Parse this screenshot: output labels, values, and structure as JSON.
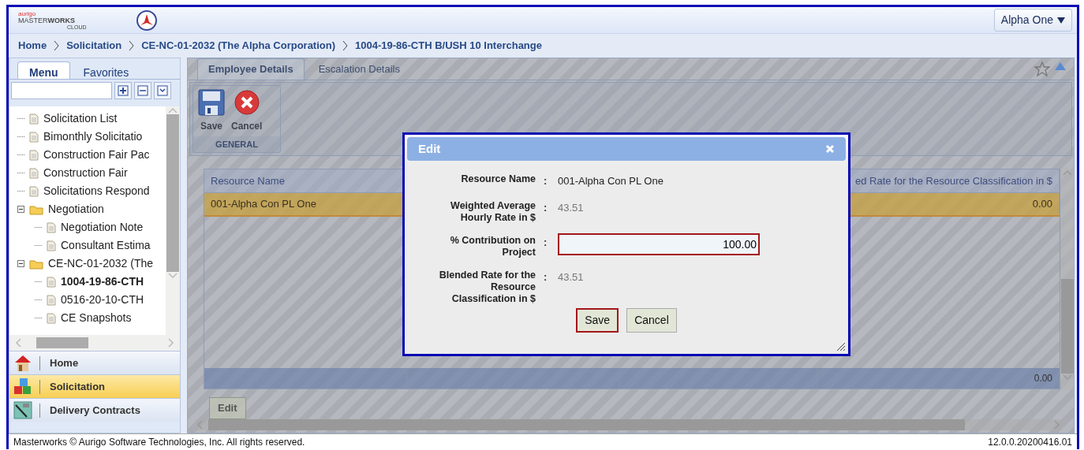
{
  "header": {
    "logo": {
      "brand": "aurigo",
      "name": "MASTER**WORKS**",
      "tagline": "CLOUD"
    },
    "user_menu": "Alpha One"
  },
  "breadcrumb": [
    "Home",
    "Solicitation",
    "CE-NC-01-2032 (The Alpha Corporation)",
    "1004-19-86-CTH B/USH 10 Interchange"
  ],
  "sidebar": {
    "tabs": [
      {
        "label": "Menu",
        "selected": true
      },
      {
        "label": "Favorites",
        "selected": false
      }
    ],
    "tree": [
      {
        "label": "Solicitation List",
        "kind": "page",
        "selected": false
      },
      {
        "label": "Bimonthly Solicitatio",
        "kind": "page",
        "selected": false
      },
      {
        "label": "Construction Fair Pac",
        "kind": "page",
        "selected": false
      },
      {
        "label": "Construction Fair",
        "kind": "page",
        "selected": false
      },
      {
        "label": "Solicitations Respond",
        "kind": "page",
        "selected": false
      },
      {
        "label": "Negotiation",
        "kind": "folder",
        "expanded": true,
        "selected": false,
        "children": [
          {
            "label": "Negotiation Note",
            "kind": "page",
            "selected": false
          },
          {
            "label": "Consultant Estima",
            "kind": "page",
            "selected": false
          }
        ]
      },
      {
        "label": "CE-NC-01-2032 (The",
        "kind": "folder",
        "expanded": true,
        "selected": false,
        "children": [
          {
            "label": "1004-19-86-CTH",
            "kind": "page",
            "selected": true
          },
          {
            "label": "0516-20-10-CTH",
            "kind": "page",
            "selected": false
          },
          {
            "label": "CE Snapshots",
            "kind": "page",
            "selected": false
          }
        ]
      }
    ],
    "nav": [
      {
        "label": "Home",
        "kind": "home",
        "selected": false
      },
      {
        "label": "Solicitation",
        "kind": "blocks",
        "selected": true
      },
      {
        "label": "Delivery Contracts",
        "kind": "contract",
        "selected": false
      }
    ]
  },
  "main": {
    "tabs": [
      {
        "label": "Employee Details",
        "selected": true
      },
      {
        "label": "Escalation Details",
        "selected": false
      }
    ],
    "toolbar": {
      "buttons": [
        {
          "label": "Save",
          "kind": "save"
        },
        {
          "label": "Cancel",
          "kind": "cancel"
        }
      ],
      "group": "GENERAL"
    },
    "grid": {
      "column_1": "Resource Name",
      "column_4": "ed Rate for the Resource Classification in $",
      "rows": [
        {
          "column_1": "001-Alpha Con PL One",
          "column_4": "0.00",
          "selected": true
        }
      ],
      "totals": {
        "column_4": "0.00"
      }
    },
    "edit_button": "Edit"
  },
  "dialog": {
    "title": "Edit",
    "fields": [
      {
        "label": "Resource Name",
        "separator": ":",
        "kind": "text",
        "value": "001-Alpha Con PL One"
      },
      {
        "label": "Weighted Average Hourly Rate in $",
        "separator": ":",
        "kind": "readonly",
        "value": "43.51"
      },
      {
        "label": "% Contribution on Project",
        "separator": ":",
        "kind": "input",
        "value": "100.00"
      },
      {
        "label": "Blended Rate for the Resource Classification in $",
        "separator": ":",
        "kind": "readonly",
        "value": "43.51"
      }
    ],
    "buttons": [
      {
        "label": "Save",
        "focused": true
      },
      {
        "label": "Cancel",
        "focused": false
      }
    ]
  },
  "status_bar": {
    "copyright": "Masterworks © Aurigo Software Technologies, Inc. All rights reserved.",
    "version": "12.0.0.20200416.01"
  }
}
